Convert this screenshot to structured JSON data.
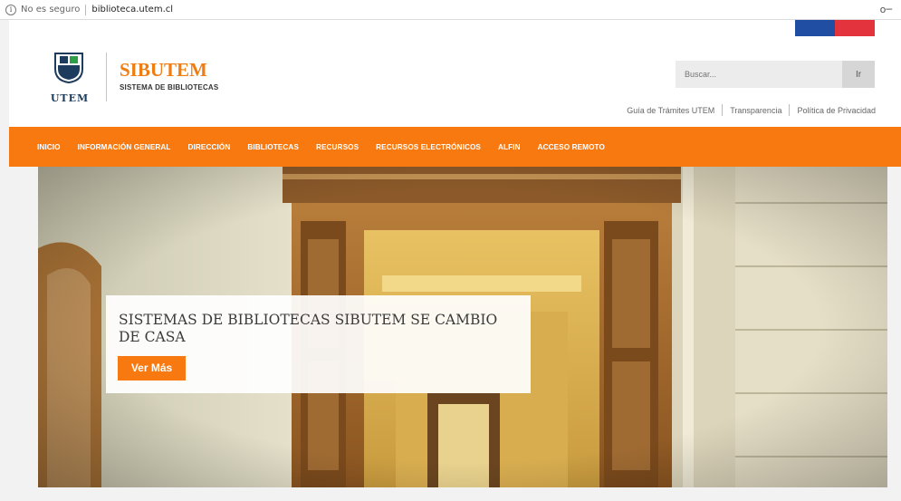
{
  "browser": {
    "security_text": "No es seguro",
    "url": "biblioteca.utem.cl",
    "info_icon": "info-icon",
    "key_icon": "key-icon"
  },
  "header": {
    "logo_text": "UTEM",
    "brand_name": "SIBUTEM",
    "brand_subtitle": "SISTEMA DE BIBLIOTECAS",
    "search_placeholder": "Buscar...",
    "search_button": "Ir",
    "links": [
      "Guía de Trámites UTEM",
      "Transparencia",
      "Política de Privacidad"
    ],
    "flag_colors": [
      "#1f4ea3",
      "#e3333c"
    ]
  },
  "nav": {
    "items": [
      "INICIO",
      "INFORMACIÓN GENERAL",
      "DIRECCIÓN",
      "BIBLIOTECAS",
      "RECURSOS",
      "RECURSOS ELECTRÓNICOS",
      "ALFIN",
      "ACCESO REMOTO"
    ],
    "color": "#f7790f"
  },
  "hero": {
    "title": "SISTEMAS DE BIBLIOTECAS SIBUTEM SE CAMBIO DE CASA",
    "button": "Ver Más"
  }
}
